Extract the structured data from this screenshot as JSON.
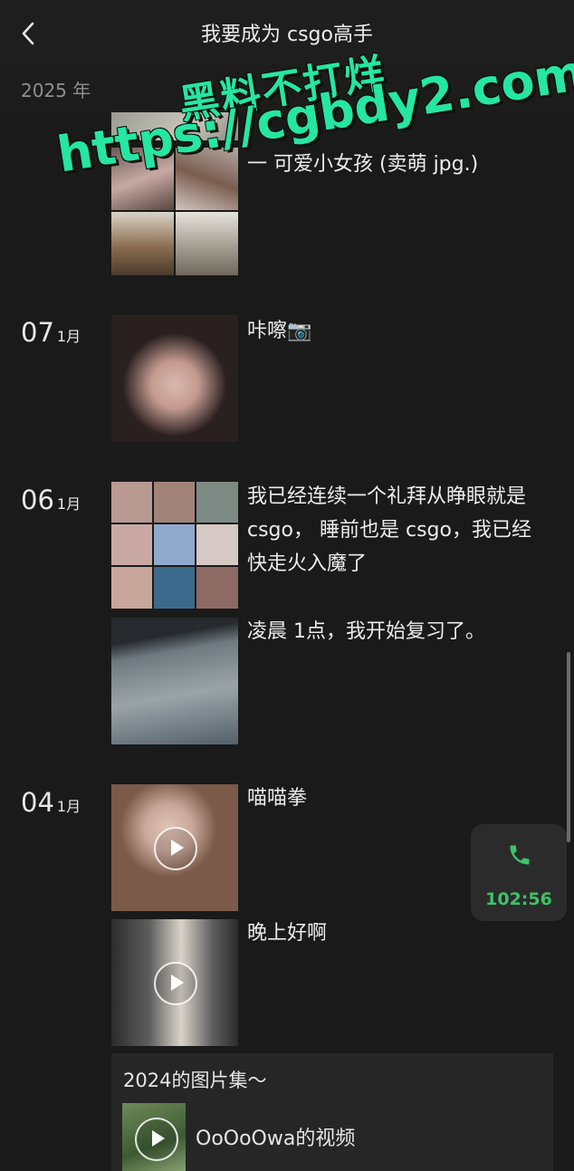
{
  "header": {
    "title": "我要成为 csgo高手",
    "back_icon": "chevron-left-icon"
  },
  "year_label": "2025 年",
  "posts": [
    {
      "day": "",
      "month": "",
      "text": "一  可爱小女孩 (卖萌 jpg.)"
    },
    {
      "day": "07",
      "month": "1月",
      "text": "咔嚓📷"
    },
    {
      "day": "06",
      "month": "1月",
      "text": "我已经连续一个礼拜从睁眼就是 csgo， 睡前也是 csgo，我已经快走火入魔了"
    },
    {
      "day": "",
      "month": "",
      "text": "凌晨 1点，我开始复习了。"
    },
    {
      "day": "04",
      "month": "1月",
      "text": "喵喵拳"
    },
    {
      "day": "",
      "month": "",
      "text": "晚上好啊"
    }
  ],
  "album": {
    "title": "2024的图片集～",
    "subtitle": "OoOoOwa的视频"
  },
  "call": {
    "icon": "phone-icon",
    "time": "102:56",
    "color": "#3ec26a"
  },
  "watermark": {
    "line1": "黑料不打烊",
    "line2": "https://cgbdy2.com",
    "color": "#25e6a2"
  }
}
